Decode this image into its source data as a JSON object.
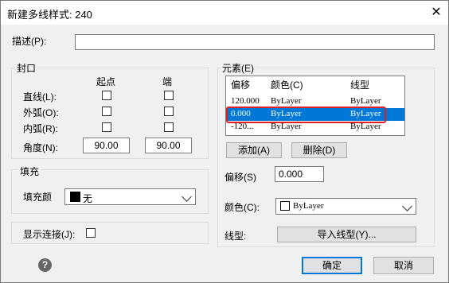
{
  "window": {
    "title": "新建多线样式: 240",
    "close_glyph": "✕"
  },
  "description": {
    "label": "描述(P):",
    "value": ""
  },
  "caps": {
    "group_label": "封口",
    "col_start": "起点",
    "col_end": "端",
    "rows": [
      {
        "label": "直线(L):",
        "start_checked": false,
        "end_checked": false
      },
      {
        "label": "外弧(O):",
        "start_checked": false,
        "end_checked": false
      },
      {
        "label": "内弧(R):",
        "start_checked": false,
        "end_checked": false
      }
    ],
    "angle_label": "角度(N):",
    "angle_start": "90.00",
    "angle_end": "90.00"
  },
  "fill": {
    "group_label": "填充",
    "color_label": "填充颜",
    "color_value": "无",
    "swatch_color": "#000000"
  },
  "show_joints": {
    "label": "显示连接(J):",
    "checked": false
  },
  "elements": {
    "group_label": "元素(E)",
    "headers": {
      "offset": "偏移",
      "color": "颜色(C)",
      "linetype": "线型"
    },
    "rows": [
      {
        "offset": "120.000",
        "color": "ByLayer",
        "linetype": "ByLayer",
        "selected": false
      },
      {
        "offset": "0.000",
        "color": "ByLayer",
        "linetype": "ByLayer",
        "selected": true
      },
      {
        "offset": "-120...",
        "color": "ByLayer",
        "linetype": "ByLayer",
        "selected": false
      }
    ],
    "add_button": "添加(A)",
    "delete_button": "删除(D)",
    "offset_label": "偏移(S)",
    "offset_value": "0.000",
    "color_label": "颜色(C):",
    "color_value": "ByLayer",
    "linetype_label": "线型:",
    "linetype_button": "导入线型(Y)..."
  },
  "footer": {
    "help_glyph": "?",
    "ok": "确定",
    "cancel": "取消"
  },
  "colors": {
    "selection": "#0078d7",
    "highlight_box": "#e02020"
  }
}
